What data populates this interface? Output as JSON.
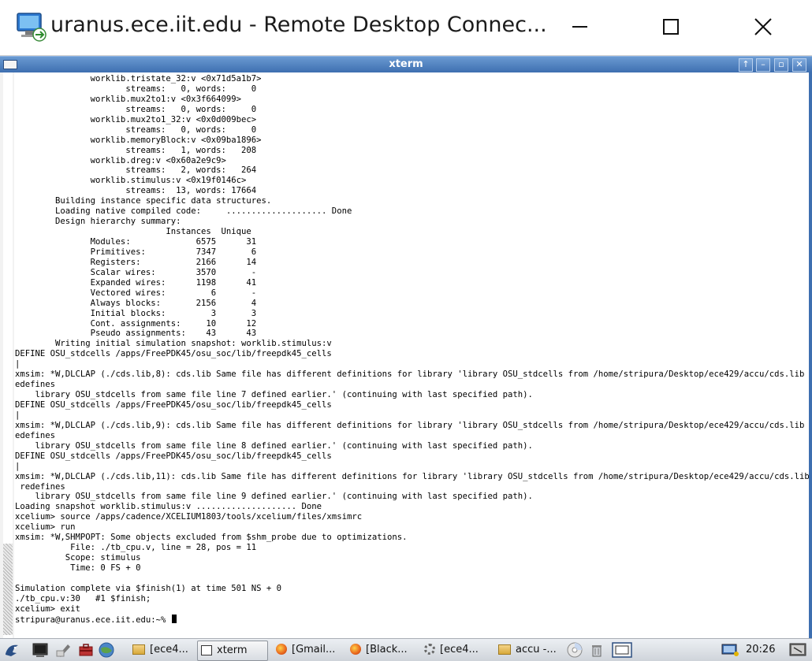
{
  "rdc": {
    "title": "uranus.ece.iit.edu - Remote Desktop Connec..."
  },
  "xterm": {
    "title": "xterm",
    "buttons": [
      "↑",
      "–",
      "▫",
      "✕"
    ]
  },
  "terminal": {
    "lines": [
      "               worklib.tristate_32:v <0x71d5a1b7>",
      "                      streams:   0, words:     0",
      "               worklib.mux2to1:v <0x3f664099>",
      "                      streams:   0, words:     0",
      "               worklib.mux2to1_32:v <0x0d009bec>",
      "                      streams:   0, words:     0",
      "               worklib.memoryBlock:v <0x09ba1896>",
      "                      streams:   1, words:   208",
      "               worklib.dreg:v <0x60a2e9c9>",
      "                      streams:   2, words:   264",
      "               worklib.stimulus:v <0x19f0146c>",
      "                      streams:  13, words: 17664",
      "        Building instance specific data structures.",
      "        Loading native compiled code:     .................... Done",
      "        Design hierarchy summary:",
      "                              Instances  Unique",
      "               Modules:             6575      31",
      "               Primitives:          7347       6",
      "               Registers:           2166      14",
      "               Scalar wires:        3570       -",
      "               Expanded wires:      1198      41",
      "               Vectored wires:         6       -",
      "               Always blocks:       2156       4",
      "               Initial blocks:         3       3",
      "               Cont. assignments:     10      12",
      "               Pseudo assignments:    43      43",
      "        Writing initial simulation snapshot: worklib.stimulus:v",
      "DEFINE OSU_stdcells /apps/FreePDK45/osu_soc/lib/freepdk45_cells",
      "|",
      "xmsim: *W,DLCLAP (./cds.lib,8): cds.lib Same file has different definitions for library 'library OSU_stdcells from /home/stripura/Desktop/ece429/accu/cds.lib line 8, r",
      "edefines",
      "    library OSU_stdcells from same file line 7 defined earlier.' (continuing with last specified path).",
      "DEFINE OSU_stdcells /apps/FreePDK45/osu_soc/lib/freepdk45_cells",
      "|",
      "xmsim: *W,DLCLAP (./cds.lib,9): cds.lib Same file has different definitions for library 'library OSU_stdcells from /home/stripura/Desktop/ece429/accu/cds.lib line 9, r",
      "edefines",
      "    library OSU_stdcells from same file line 8 defined earlier.' (continuing with last specified path).",
      "DEFINE OSU_stdcells /apps/FreePDK45/osu_soc/lib/freepdk45_cells",
      "|",
      "xmsim: *W,DLCLAP (./cds.lib,11): cds.lib Same file has different definitions for library 'library OSU_stdcells from /home/stripura/Desktop/ece429/accu/cds.lib line 11,",
      " redefines",
      "    library OSU_stdcells from same file line 9 defined earlier.' (continuing with last specified path).",
      "Loading snapshot worklib.stimulus:v .................... Done",
      "xcelium> source /apps/cadence/XCELIUM1803/tools/xcelium/files/xmsimrc",
      "xcelium> run",
      "xmsim: *W,SHMPOPT: Some objects excluded from $shm_probe due to optimizations.",
      "           File: ./tb_cpu.v, line = 28, pos = 11",
      "          Scope: stimulus",
      "           Time: 0 FS + 0",
      "",
      "Simulation complete via $finish(1) at time 501 NS + 0",
      "./tb_cpu.v:30   #1 $finish;",
      "xcelium> exit",
      "stripura@uranus.ece.iit.edu:~% "
    ]
  },
  "taskbar": {
    "tasks": [
      {
        "label": "[ece4...",
        "icon": "folder-icon"
      },
      {
        "label": "xterm",
        "icon": "terminal-icon",
        "active": true
      },
      {
        "label": "[Gmail...",
        "icon": "firefox-icon"
      },
      {
        "label": "[Black...",
        "icon": "firefox-icon"
      },
      {
        "label": "[ece4...",
        "icon": "gear-icon"
      },
      {
        "label": "accu -...",
        "icon": "folder-icon"
      }
    ],
    "clock": "20:26"
  },
  "colors": {
    "titlebar_blue": "#3e6fb0",
    "terminal_bg": "#ffffff",
    "terminal_fg": "#000000"
  }
}
